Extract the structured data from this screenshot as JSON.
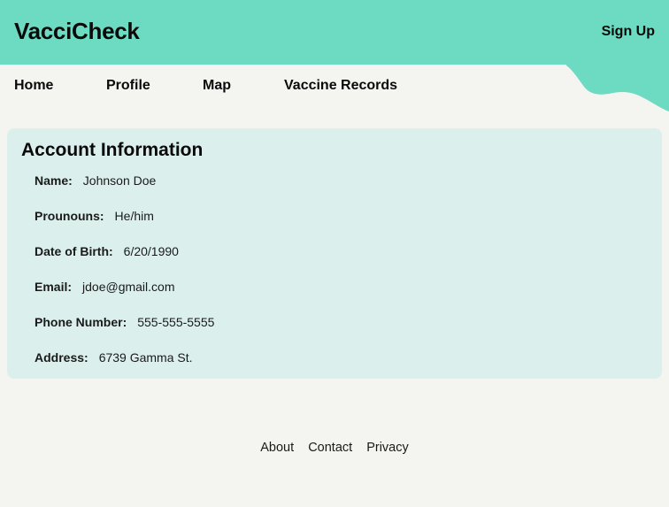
{
  "header": {
    "brand": "VacciCheck",
    "signup_label": "Sign Up"
  },
  "nav": {
    "items": [
      "Home",
      "Profile",
      "Map",
      "Vaccine Records"
    ]
  },
  "account": {
    "title": "Account Information",
    "fields": [
      {
        "label": "Name:",
        "value": "Johnson Doe"
      },
      {
        "label": "Prounouns:",
        "value": "He/him"
      },
      {
        "label": "Date of Birth:",
        "value": "6/20/1990"
      },
      {
        "label": "Email:",
        "value": "jdoe@gmail.com"
      },
      {
        "label": "Phone Number:",
        "value": "555-555-5555"
      },
      {
        "label": "Address:",
        "value": "6739 Gamma St."
      }
    ]
  },
  "footer": {
    "links": [
      "About",
      "Contact",
      "Privacy"
    ]
  },
  "colors": {
    "header_bg": "#6ddbc1",
    "page_bg": "#f4f4f0",
    "card_bg": "#dbf0ed"
  }
}
